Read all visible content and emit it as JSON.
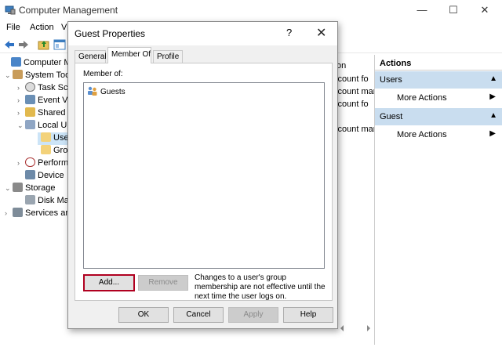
{
  "window": {
    "title": "Computer Management",
    "controls": {
      "minimize": "—",
      "maximize": "☐",
      "close": "✕"
    }
  },
  "menu": {
    "file": "File",
    "action": "Action",
    "view": "V"
  },
  "tree": [
    {
      "label": "Computer Ma",
      "expander": "",
      "icon": "computer-icon"
    },
    {
      "label": "System Too",
      "expander": "⌄",
      "icon": "tools-icon"
    },
    {
      "label": "Task Sch",
      "expander": "›",
      "icon": "clock-icon"
    },
    {
      "label": "Event V",
      "expander": "›",
      "icon": "event-viewer-icon"
    },
    {
      "label": "Shared",
      "expander": "›",
      "icon": "shared-folder-icon"
    },
    {
      "label": "Local U",
      "expander": "⌄",
      "icon": "users-icon"
    },
    {
      "label": "Use",
      "expander": "",
      "icon": "folder-icon"
    },
    {
      "label": "Gro",
      "expander": "",
      "icon": "folder-icon"
    },
    {
      "label": "Perform",
      "expander": "›",
      "icon": "performance-icon"
    },
    {
      "label": "Device",
      "expander": "",
      "icon": "device-icon"
    },
    {
      "label": "Storage",
      "expander": "⌄",
      "icon": "storage-icon"
    },
    {
      "label": "Disk Ma",
      "expander": "",
      "icon": "disk-icon"
    },
    {
      "label": "Services an",
      "expander": "›",
      "icon": "services-icon"
    }
  ],
  "middle": {
    "header": "on",
    "rows": [
      "ccount fo",
      "ccount mar",
      "ccount fo",
      "ccount mar"
    ]
  },
  "actions": {
    "title": "Actions",
    "sections": [
      {
        "label": "Users",
        "item": "More Actions"
      },
      {
        "label": "Guest",
        "item": "More Actions"
      }
    ]
  },
  "dialog": {
    "title": "Guest Properties",
    "help": "?",
    "close": "✕",
    "tabs": [
      "General",
      "Member Of",
      "Profile"
    ],
    "active_tab": "Member Of",
    "member_label": "Member of:",
    "members": [
      "Guests"
    ],
    "add_button": "Add...",
    "remove_button": "Remove",
    "note": "Changes to a user's group membership are not effective until the next time the user logs on.",
    "ok_button": "OK",
    "cancel_button": "Cancel",
    "apply_button": "Apply",
    "help_button": "Help"
  },
  "colors": {
    "accent": "#c9ddef",
    "focus_border": "#b00020"
  }
}
